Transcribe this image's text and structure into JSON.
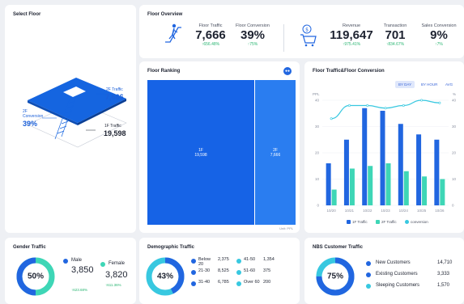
{
  "select_floor": {
    "title": "Select Floor",
    "floor2_label": "2F Traffic",
    "floor2_value": "7,666",
    "floor2_conv_label": "2F\nConversion",
    "floor2_conv_value": "39%",
    "floor1_label": "1F Traffic",
    "floor1_value": "19,598"
  },
  "overview": {
    "title": "Floor Overview",
    "floor_traffic": {
      "label": "Floor Traffic",
      "value": "7,666",
      "delta": "↑656.48%"
    },
    "floor_conversion": {
      "label": "Floor Conversion",
      "value": "39%",
      "delta": "↑75%"
    },
    "revenue": {
      "label": "Revenue",
      "value": "119,647",
      "delta": "↑975.41%"
    },
    "transaction": {
      "label": "Transaction",
      "value": "701",
      "delta": "↑834.67%"
    },
    "sales_conversion": {
      "label": "Sales Conversion",
      "value": "9%",
      "delta": "↑7%"
    }
  },
  "ranking": {
    "title": "Floor Ranking",
    "unit": "Unit: PPL",
    "blocks": [
      {
        "label": "1F",
        "value": "19,598",
        "share": 0.72
      },
      {
        "label": "2F",
        "value": "7,666",
        "share": 0.28
      }
    ]
  },
  "conversion": {
    "title": "Floor Traffic&Floor Conversion",
    "toggles": [
      "BY DAY",
      "BY HOUR",
      "AVG"
    ],
    "active_toggle": 0,
    "left_unit": "PPL",
    "right_unit": "%",
    "legend": [
      "1F Traffic",
      "2F Traffic",
      "conversion"
    ],
    "colors": {
      "f1": "#2166e0",
      "f2": "#3ed6b6",
      "conv": "#38c8e0"
    }
  },
  "chart_data": {
    "type": "bar",
    "categories": [
      "10/20",
      "10/21",
      "10/22",
      "10/23",
      "10/24",
      "10/25",
      "10/26"
    ],
    "series": [
      {
        "name": "1F Traffic",
        "values": [
          16,
          25,
          37,
          36,
          31,
          27,
          25
        ]
      },
      {
        "name": "2F Traffic",
        "values": [
          6,
          14,
          15,
          16,
          13,
          11,
          10
        ]
      },
      {
        "name": "conversion",
        "values": [
          33,
          38,
          38,
          37,
          38,
          40,
          39
        ]
      }
    ],
    "y_left_ticks": [
      "0",
      "10",
      "20",
      "30",
      "40"
    ],
    "y_right_ticks": [
      "0",
      "10",
      "20",
      "30",
      "40"
    ],
    "ylim": [
      0,
      40
    ]
  },
  "gender": {
    "title": "Gender Traffic",
    "percent": "50%",
    "male": {
      "label": "Male",
      "value": "3,850",
      "delta": "↑623.68%"
    },
    "female": {
      "label": "Female",
      "value": "3,820",
      "delta": "↑611.36%"
    }
  },
  "demo": {
    "title": "Demographic Traffic",
    "percent": "43%",
    "groups": [
      {
        "label": "Below 20",
        "value": "2,375"
      },
      {
        "label": "21-30",
        "value": "8,525"
      },
      {
        "label": "31-40",
        "value": "6,785"
      },
      {
        "label": "41-50",
        "value": "1,354"
      },
      {
        "label": "51-60",
        "value": "375"
      },
      {
        "label": "Over 60",
        "value": "200"
      }
    ]
  },
  "nbs": {
    "title": "NBS Customer Traffic",
    "percent": "75%",
    "items": [
      {
        "label": "New Customers",
        "value": "14,710"
      },
      {
        "label": "Existing Customers",
        "value": "3,333"
      },
      {
        "label": "Sleeping Customers",
        "value": "1,570"
      }
    ]
  }
}
